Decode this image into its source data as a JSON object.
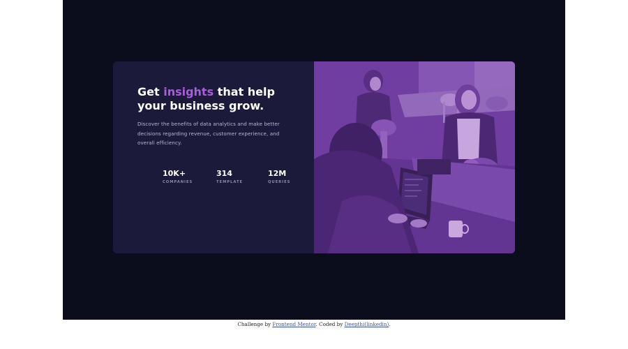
{
  "hero": {
    "headline_start": "Get ",
    "headline_accent": "insights",
    "headline_end": " that help your business grow.",
    "description": "Discover the benefits of data analytics and make better decisions regarding revenue, customer experience, and overall efficiency."
  },
  "stats": [
    {
      "value": "10K+",
      "label": "COMPANIES"
    },
    {
      "value": "314",
      "label": "TEMPLATE"
    },
    {
      "value": "12M",
      "label": "QUERIES"
    }
  ],
  "attribution": {
    "prefix": "Challenge by ",
    "link1": "Frontend Mentor",
    "middle": ". Coded by ",
    "link2": "Deepthi(linkedin)",
    "suffix": "."
  },
  "colors": {
    "page_background": "#0b0c1c",
    "card_background": "#1c1a3b",
    "accent": "#a95fd8",
    "image_overlay": "#6a3c97"
  }
}
